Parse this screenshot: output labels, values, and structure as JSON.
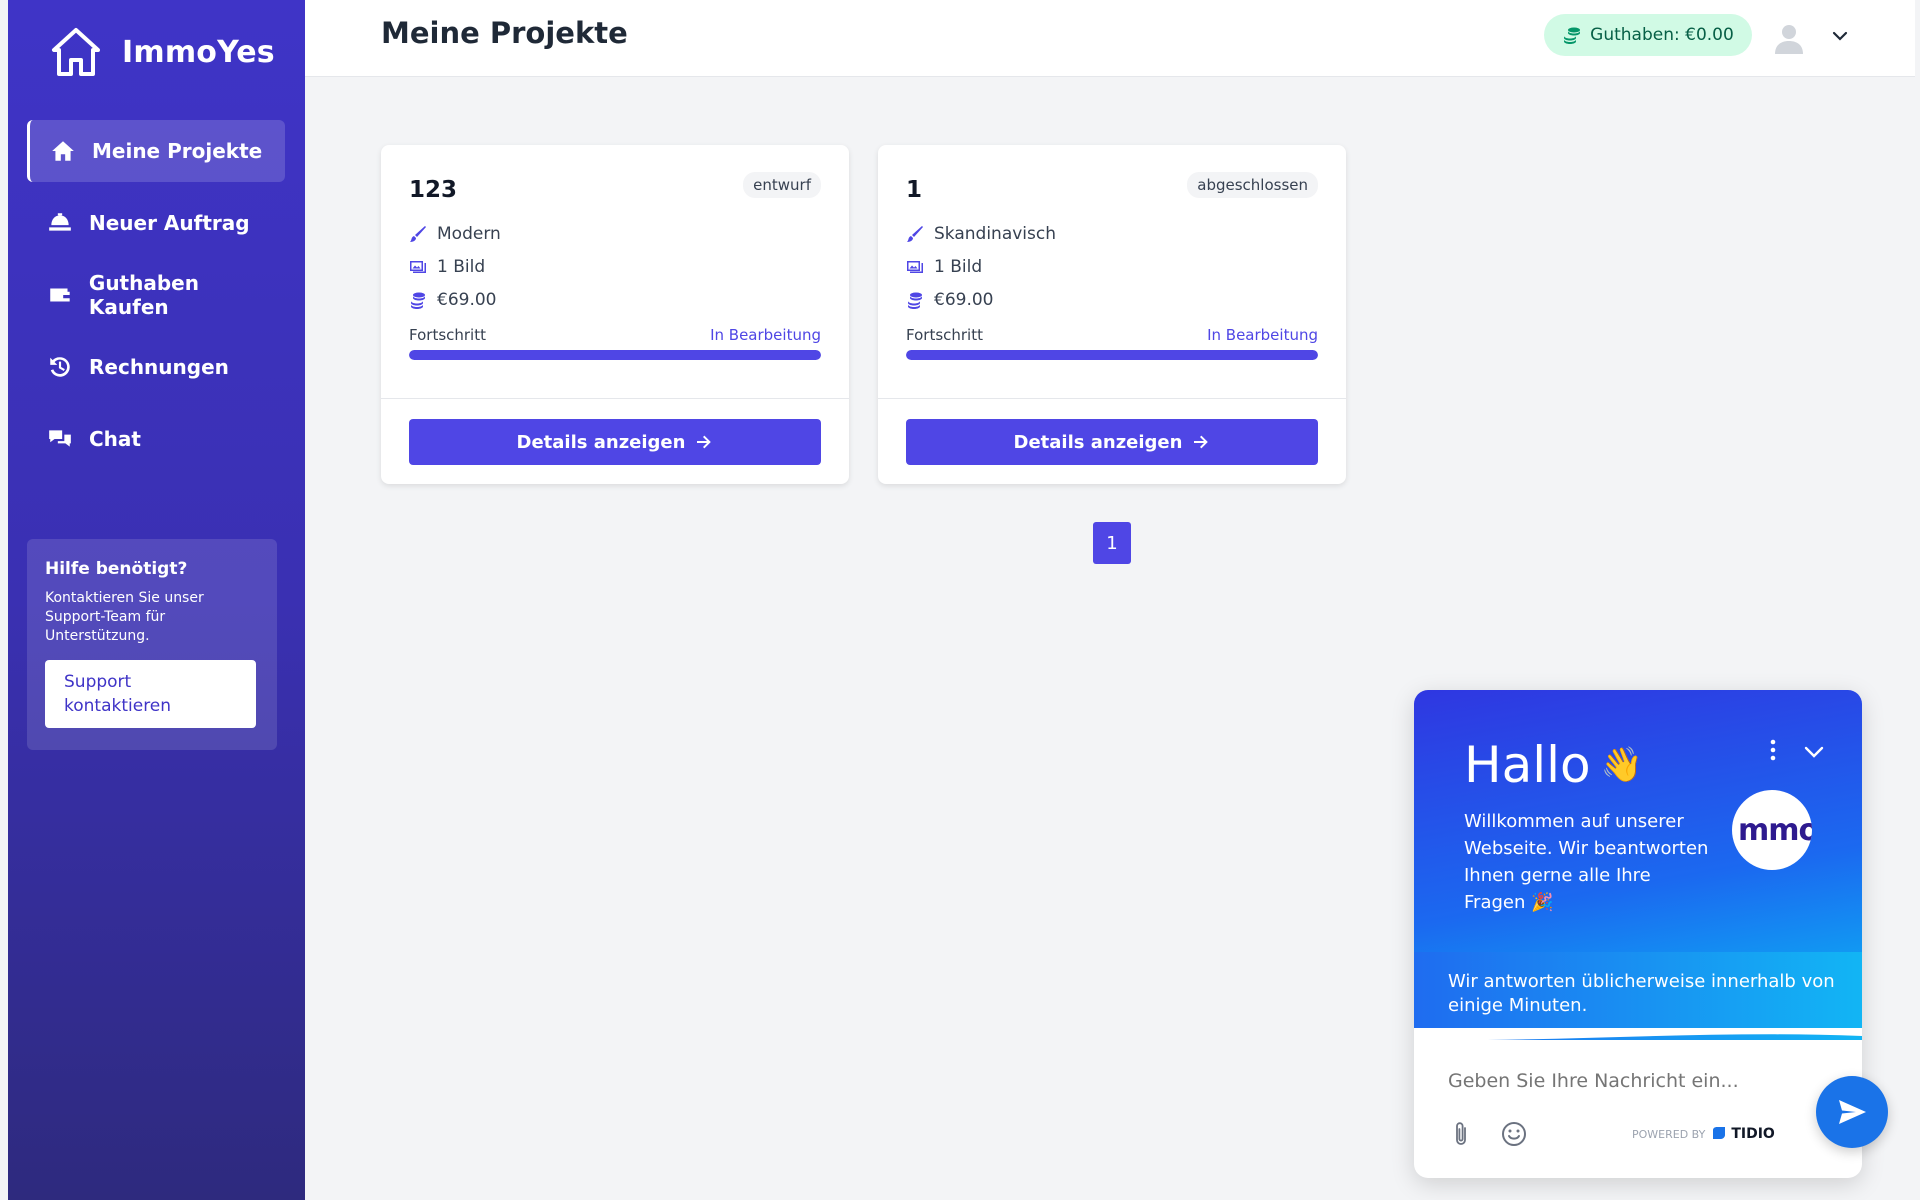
{
  "brand": {
    "name": "ImmoYes"
  },
  "sidebar": {
    "items": [
      {
        "label": "Meine Projekte",
        "icon": "home-icon",
        "active": true
      },
      {
        "label": "Neuer Auftrag",
        "icon": "bell-icon"
      },
      {
        "label": "Guthaben Kaufen",
        "icon": "wallet-icon"
      },
      {
        "label": "Rechnungen",
        "icon": "history-icon"
      },
      {
        "label": "Chat",
        "icon": "chat-icon"
      }
    ],
    "help": {
      "title": "Hilfe benötigt?",
      "text": "Kontaktieren Sie unser Support-Team für Unterstützung.",
      "button": "Support kontaktieren"
    }
  },
  "header": {
    "title": "Meine Projekte",
    "balance": "Guthaben: €0.00",
    "accent": "#4f46e5"
  },
  "projects": [
    {
      "title": "123",
      "status": "entwurf",
      "style": "Modern",
      "images": "1 Bild",
      "price": "€69.00",
      "progress_label": "Fortschritt",
      "progress_status": "In Bearbeitung",
      "progress": 1.0,
      "button": "Details anzeigen"
    },
    {
      "title": "1",
      "status": "abgeschlossen",
      "style": "Skandinavisch",
      "images": "1 Bild",
      "price": "€69.00",
      "progress_label": "Fortschritt",
      "progress_status": "In Bearbeitung",
      "progress": 1.0,
      "button": "Details anzeigen"
    }
  ],
  "pagination": {
    "current": "1"
  },
  "chat": {
    "greeting": "Hallo",
    "greeting_emoji": "👋",
    "welcome": "Willkommen auf unserer Webseite. Wir beantworten Ihnen gerne alle Ihre Fragen 🎉",
    "bot_logo_text": "mmo",
    "response_time": "Wir antworten üblicherweise innerhalb von einige Minuten.",
    "input_placeholder": "Geben Sie Ihre Nachricht ein...",
    "powered_by": "POWERED BY",
    "powered_brand": "TIDIO"
  }
}
